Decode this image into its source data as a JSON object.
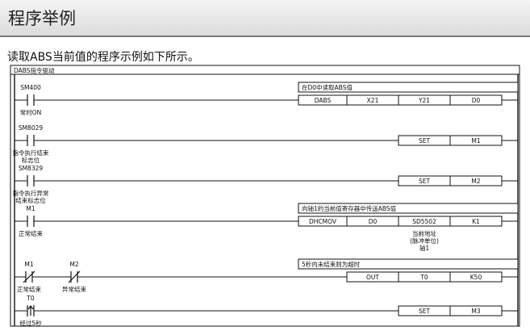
{
  "header": {
    "title": "程序举例"
  },
  "intro": {
    "text": "读取ABS当前值的程序示例如下所示。"
  },
  "diagram": {
    "title": "DABS指令驱动",
    "rungs": [
      {
        "contacts": [
          {
            "device": "SM400",
            "type": "NO",
            "comment": [
              "常时ON"
            ]
          }
        ],
        "instruction": [
          "DABS",
          "X21",
          "Y21",
          "D0"
        ],
        "comment": "在D0中读取ABS值"
      },
      {
        "contacts": [
          {
            "device": "SM8029",
            "type": "NO",
            "comment": [
              "指令执行结束",
              "标志位"
            ]
          }
        ],
        "instruction": [
          "",
          "",
          "SET",
          "M1"
        ]
      },
      {
        "contacts": [
          {
            "device": "SM8329",
            "type": "NO",
            "comment": [
              "指令执行异常",
              "结束标志位"
            ]
          }
        ],
        "instruction": [
          "",
          "",
          "SET",
          "M2"
        ]
      },
      {
        "contacts": [
          {
            "device": "M1",
            "type": "NO",
            "comment": [
              "正常结束"
            ]
          }
        ],
        "instruction": [
          "DHCMOV",
          "D0",
          "SD5502",
          "K1"
        ],
        "comment": "向轴1的当前值寄存器中传送ABS值",
        "operand_note": [
          "当前地址",
          "(脉冲单位)",
          "轴1"
        ]
      },
      {
        "contacts": [
          {
            "device": "M1",
            "type": "NC",
            "comment": [
              "正常结束"
            ]
          },
          {
            "device": "M2",
            "type": "NC",
            "comment": [
              "异常结束"
            ]
          }
        ],
        "instruction": [
          "",
          "OUT",
          "T0",
          "K50"
        ],
        "comment": "5秒内未结束则为超时"
      },
      {
        "contacts": [
          {
            "device": "T0",
            "type": "RISE",
            "comment": [
              "经过5秒"
            ]
          }
        ],
        "instruction": [
          "",
          "",
          "SET",
          "M3"
        ]
      }
    ]
  }
}
